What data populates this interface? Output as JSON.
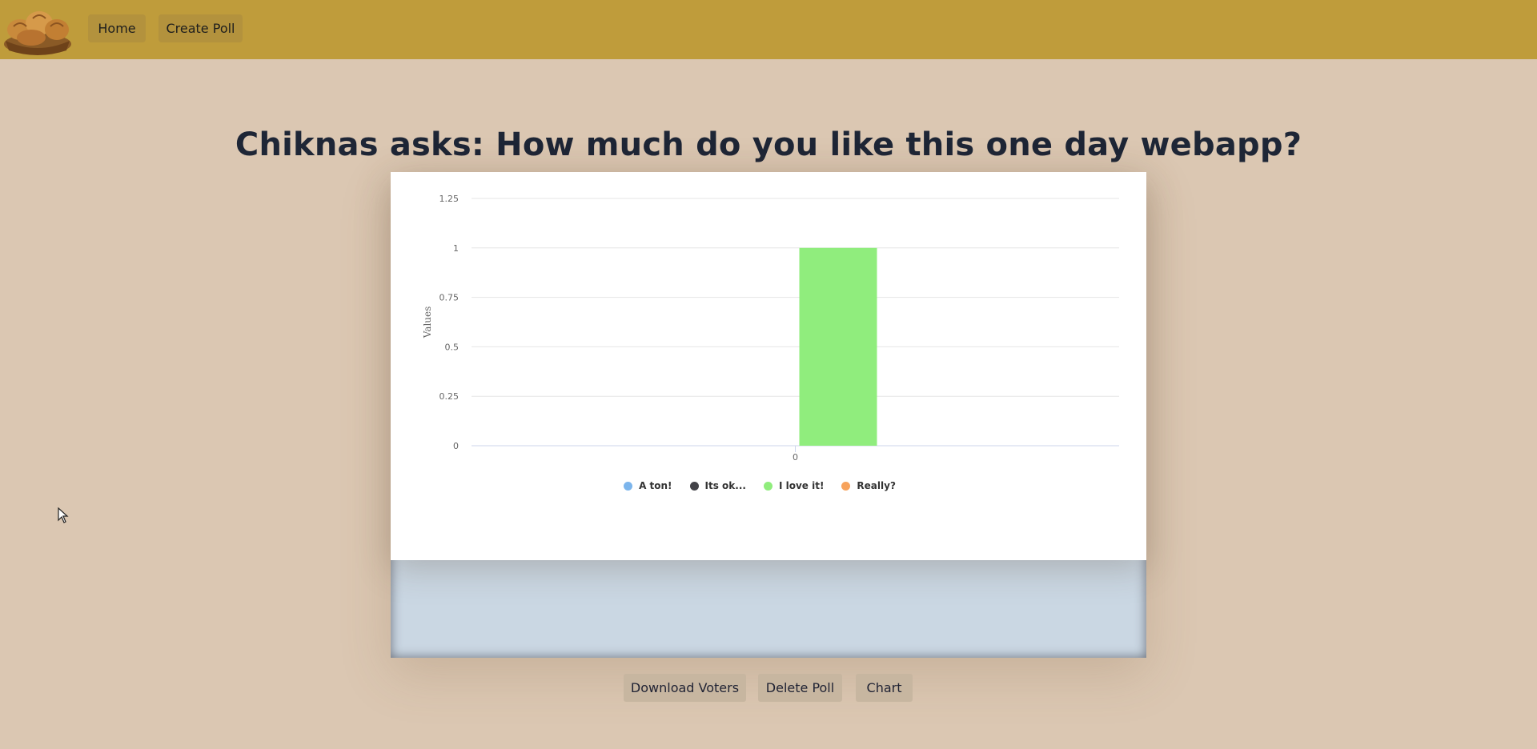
{
  "nav": {
    "home_label": "Home",
    "create_label": "Create Poll",
    "logo_icon": "bread-basket-logo"
  },
  "poll": {
    "title": "Chiknas asks: How much do you like this one day webapp?"
  },
  "actions": {
    "download_label": "Download Voters",
    "delete_label": "Delete Poll",
    "chart_label": "Chart"
  },
  "colors": {
    "navbar": "#bf9c3b",
    "background": "#dbc7b2",
    "bar": "#90ed7d"
  },
  "chart_data": {
    "type": "bar",
    "categories": [
      "0"
    ],
    "ylabel": "Values",
    "ylim": [
      0,
      1.25
    ],
    "yticks": [
      "0",
      "0.25",
      "0.5",
      "0.75",
      "1",
      "1.25"
    ],
    "grid": true,
    "legend_position": "bottom-center",
    "series": [
      {
        "name": "A ton!",
        "color": "#7cb5ec",
        "values": [
          0
        ]
      },
      {
        "name": "Its ok...",
        "color": "#434348",
        "values": [
          0
        ]
      },
      {
        "name": "I love it!",
        "color": "#90ed7d",
        "values": [
          1
        ]
      },
      {
        "name": "Really?",
        "color": "#f7a35c",
        "values": [
          0
        ]
      }
    ]
  }
}
